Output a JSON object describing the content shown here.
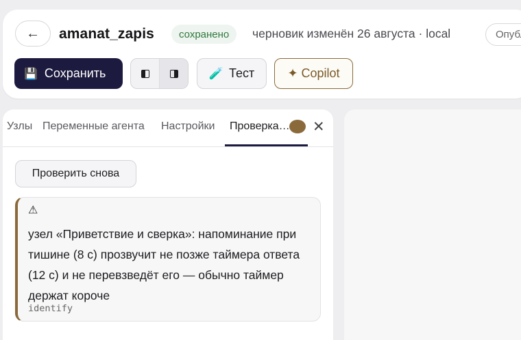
{
  "header": {
    "back_icon": "←",
    "title": "amanat_zapis",
    "saved_badge": "сохранено",
    "draft_status": "черновик изменён 26 августа · local",
    "publish_label": "Опубликовать"
  },
  "toolbar": {
    "save_icon": "💾",
    "save_label": "Сохранить",
    "test_icon": "🧪",
    "test_label": "Тест",
    "copilot_label": "✦ Copilot"
  },
  "tabs": {
    "items": [
      {
        "label": "Узлы"
      },
      {
        "label": "Переменные агента"
      },
      {
        "label": "Настройки"
      },
      {
        "label": "Проверка…"
      }
    ],
    "active_index": 3,
    "close_icon": "✕"
  },
  "validation": {
    "recheck_label": "Проверить снова",
    "issue": {
      "icon": "⚠",
      "message": "узел «Приветствие и сверка»: напоминание при тишине (8 с) прозвучит не позже таймера ответа (12 с) и не перевзведёт его — обычно таймер держат короче",
      "code": "identify"
    }
  },
  "colors": {
    "primary": "#1d1a3f",
    "accent_brown": "#8a6a3a",
    "saved_green": "#2f7a3d"
  }
}
